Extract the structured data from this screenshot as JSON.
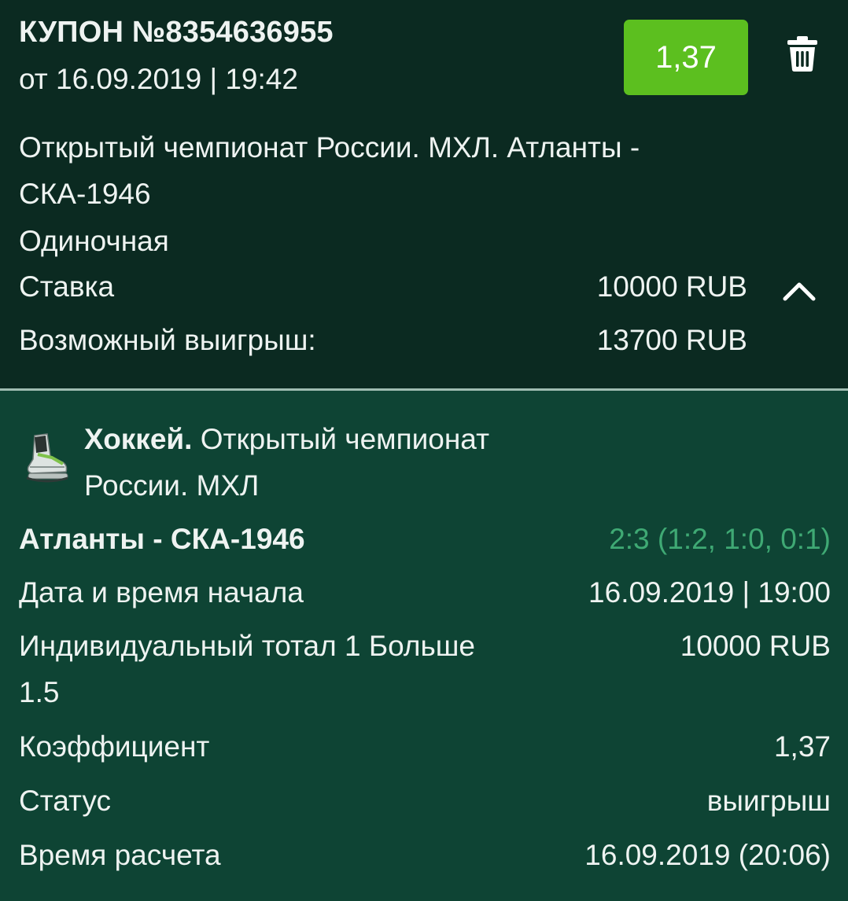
{
  "coupon": {
    "title": "КУПОН №8354636955",
    "date": "от 16.09.2019 | 19:42",
    "odds": "1,37",
    "event_line1": "Открытый чемпионат России. МХЛ. Атланты -",
    "event_line2": "СКА-1946",
    "bet_type": "Одиночная",
    "stake_label": "Ставка",
    "stake_value": "10000 RUB",
    "possible_win_label": "Возможный выигрыш:",
    "possible_win_value": "13700 RUB"
  },
  "details": {
    "sport": "Хоккей.",
    "tournament_line1": "Открытый чемпионат",
    "tournament_line2": "России. МХЛ",
    "match": "Атланты - СКА-1946",
    "score": "2:3 (1:2, 1:0, 0:1)",
    "start_label": "Дата и время начала",
    "start_value": "16.09.2019 | 19:00",
    "market_line1": "Индивидуальный тотал 1 Больше",
    "market_line2": "1.5",
    "market_value": "10000 RUB",
    "coef_label": "Коэффициент",
    "coef_value": "1,37",
    "status_label": "Статус",
    "status_value": "выигрыш",
    "settled_label": "Время расчета",
    "settled_value": "16.09.2019 (20:06)"
  },
  "icons": {
    "delete": "trash-icon",
    "collapse": "chevron-up-icon",
    "sport": "ice-skate-icon"
  },
  "colors": {
    "odds_button": "#5cbf1f",
    "score": "#3fa974",
    "header_bg": "#0b2a21",
    "details_bg": "#0e4434"
  }
}
